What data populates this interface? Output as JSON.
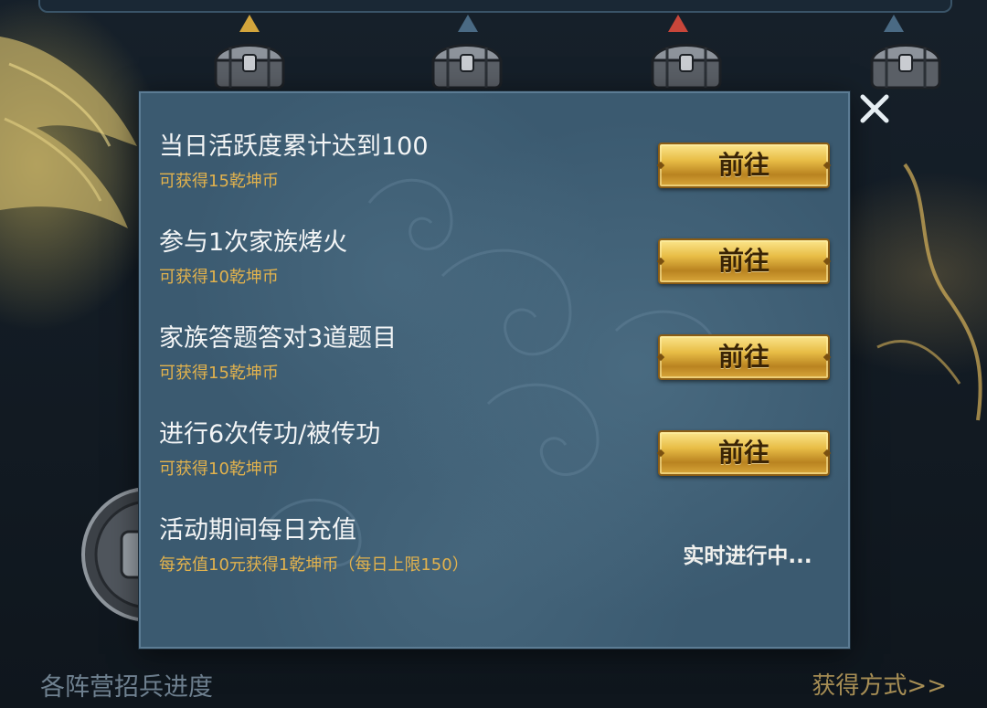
{
  "background": {
    "bottom_left_label": "各阵营招兵进度",
    "bottom_right_link": "获得方式>>",
    "chests": [
      {
        "marker": "gold"
      },
      {
        "marker": "blue"
      },
      {
        "marker": "red"
      },
      {
        "marker": "blue"
      }
    ]
  },
  "dialog": {
    "close_icon": "close-icon",
    "tasks": [
      {
        "title": "当日活跃度累计达到100",
        "reward": "可获得15乾坤币",
        "button": "前往"
      },
      {
        "title": "参与1次家族烤火",
        "reward": "可获得10乾坤币",
        "button": "前往"
      },
      {
        "title": "家族答题答对3道题目",
        "reward": "可获得15乾坤币",
        "button": "前往"
      },
      {
        "title": "进行6次传功/被传功",
        "reward": "可获得10乾坤币",
        "button": "前往"
      },
      {
        "title": "活动期间每日充值",
        "reward": "每充值10元获得1乾坤币（每日上限150）",
        "status": "实时进行中..."
      }
    ]
  },
  "colors": {
    "panel": "#3b5a70",
    "reward_text": "#e2b24d",
    "button_gold": "#e8bd46"
  }
}
